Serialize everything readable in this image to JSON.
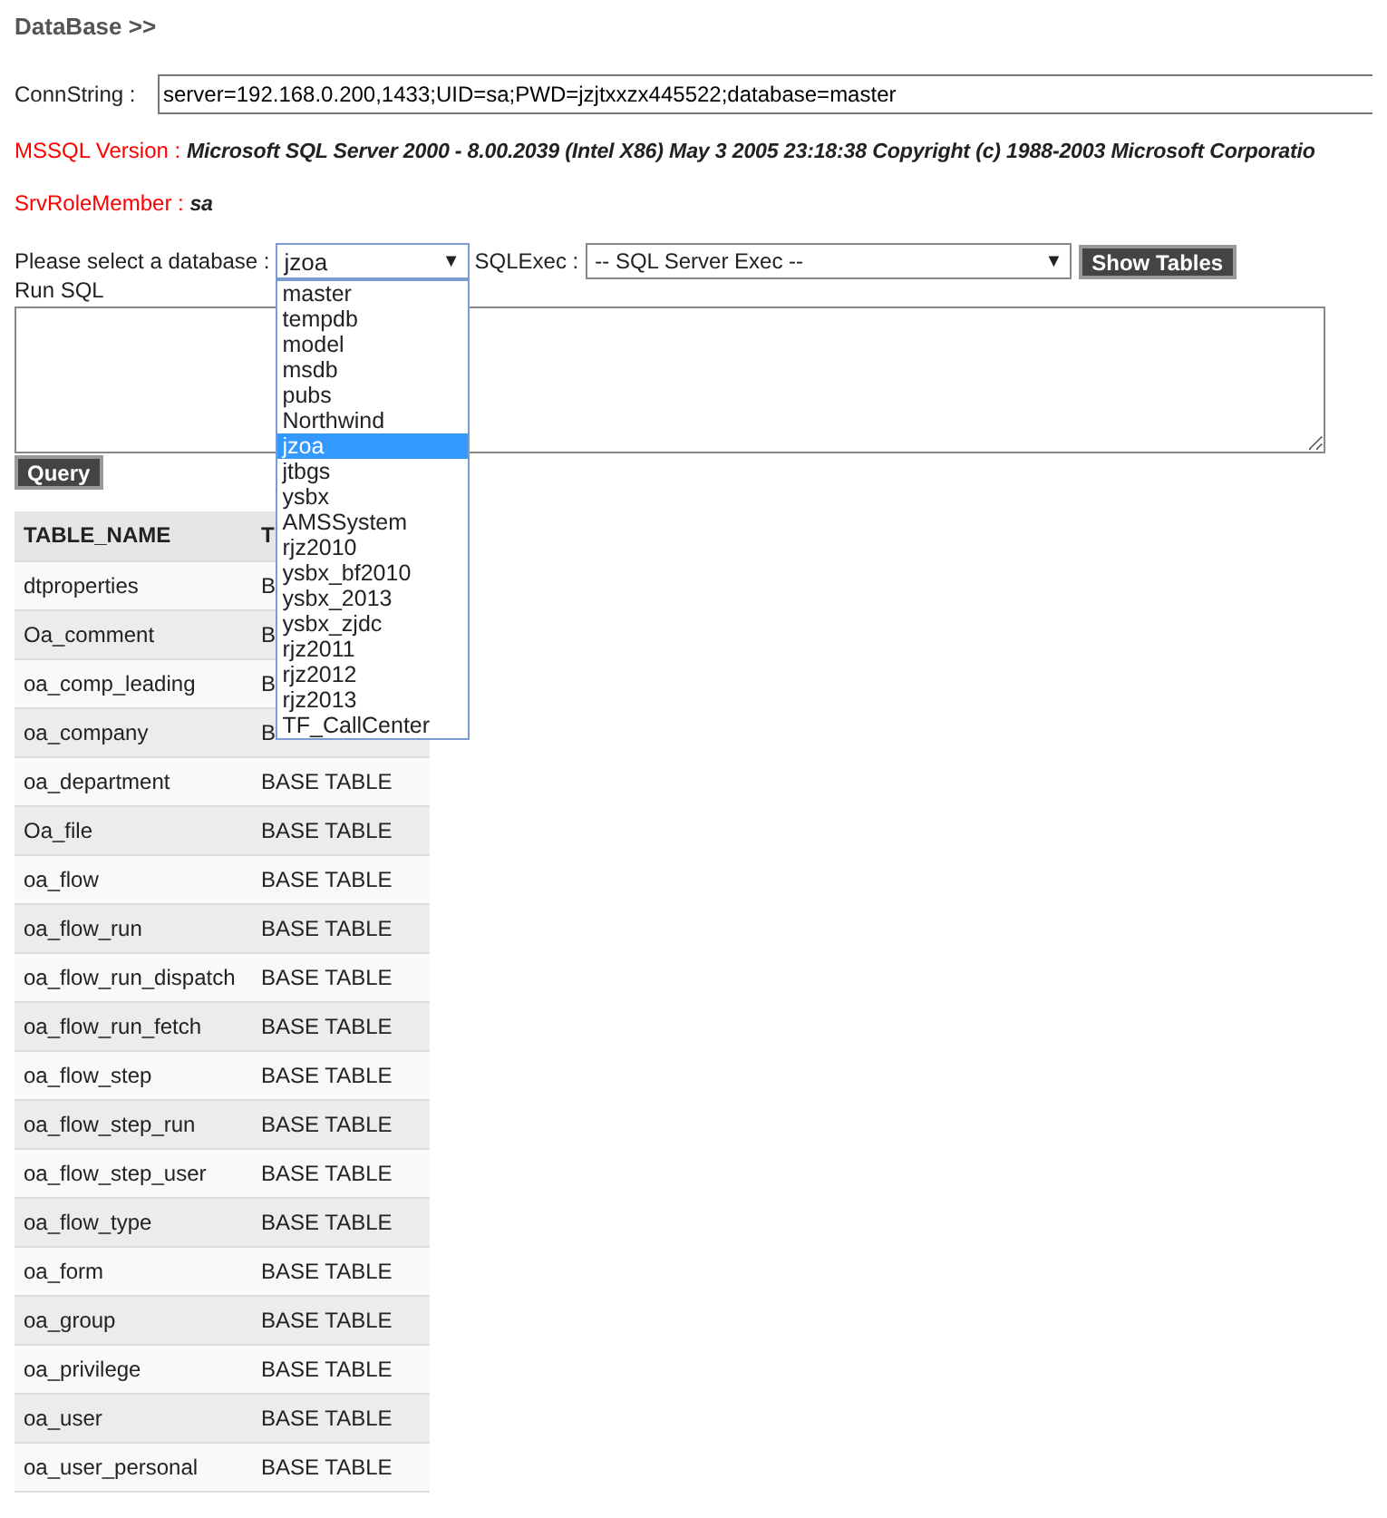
{
  "heading": "DataBase >>",
  "conn": {
    "label": "ConnString :",
    "value": "server=192.168.0.200,1433;UID=sa;PWD=jzjtxxzx445522;database=master"
  },
  "info": [
    {
      "label": "MSSQL Version",
      "sep": " : ",
      "value": "Microsoft SQL Server 2000 - 8.00.2039 (Intel X86) May 3 2005 23:18:38 Copyright (c) 1988-2003 Microsoft Corporatio"
    },
    {
      "label": "SrvRoleMember",
      "sep": " : ",
      "value": "sa"
    }
  ],
  "db_select": {
    "label": "Please select a database :",
    "value": "jzoa",
    "arrow": "▼",
    "expanded": true,
    "options": [
      {
        "label": "master",
        "selected": false
      },
      {
        "label": "tempdb",
        "selected": false
      },
      {
        "label": "model",
        "selected": false
      },
      {
        "label": "msdb",
        "selected": false
      },
      {
        "label": "pubs",
        "selected": false
      },
      {
        "label": "Northwind",
        "selected": false
      },
      {
        "label": "jzoa",
        "selected": true
      },
      {
        "label": "jtbgs",
        "selected": false
      },
      {
        "label": "ysbx",
        "selected": false
      },
      {
        "label": "AMSSystem",
        "selected": false
      },
      {
        "label": "rjz2010",
        "selected": false
      },
      {
        "label": "ysbx_bf2010",
        "selected": false
      },
      {
        "label": "ysbx_2013",
        "selected": false
      },
      {
        "label": "ysbx_zjdc",
        "selected": false
      },
      {
        "label": "rjz2011",
        "selected": false
      },
      {
        "label": "rjz2012",
        "selected": false
      },
      {
        "label": "rjz2013",
        "selected": false
      },
      {
        "label": "TF_CallCenter",
        "selected": false
      }
    ]
  },
  "sqlexec": {
    "label": "SQLExec :",
    "value": "-- SQL Server Exec --",
    "arrow": "▼"
  },
  "show_tables_button": "Show Tables",
  "run_sql": {
    "label": "Run SQL"
  },
  "query_button": "Query",
  "table": {
    "columns": [
      "TABLE_NAME",
      "T"
    ],
    "rows": [
      [
        "dtproperties",
        "B"
      ],
      [
        "Oa_comment",
        "B"
      ],
      [
        "oa_comp_leading",
        "B"
      ],
      [
        "oa_company",
        "B"
      ],
      [
        "oa_department",
        "BASE TABLE"
      ],
      [
        "Oa_file",
        "BASE TABLE"
      ],
      [
        "oa_flow",
        "BASE TABLE"
      ],
      [
        "oa_flow_run",
        "BASE TABLE"
      ],
      [
        "oa_flow_run_dispatch",
        "BASE TABLE"
      ],
      [
        "oa_flow_run_fetch",
        "BASE TABLE"
      ],
      [
        "oa_flow_step",
        "BASE TABLE"
      ],
      [
        "oa_flow_step_run",
        "BASE TABLE"
      ],
      [
        "oa_flow_step_user",
        "BASE TABLE"
      ],
      [
        "oa_flow_type",
        "BASE TABLE"
      ],
      [
        "oa_form",
        "BASE TABLE"
      ],
      [
        "oa_group",
        "BASE TABLE"
      ],
      [
        "oa_privilege",
        "BASE TABLE"
      ],
      [
        "oa_user",
        "BASE TABLE"
      ],
      [
        "oa_user_personal",
        "BASE TABLE"
      ]
    ]
  }
}
